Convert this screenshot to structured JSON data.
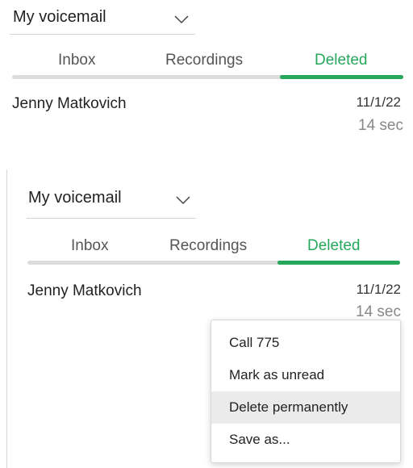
{
  "top_panel": {
    "folder_select": {
      "value": "My voicemail"
    },
    "tabs": [
      {
        "label": "Inbox"
      },
      {
        "label": "Recordings"
      },
      {
        "label": "Deleted",
        "active": true
      }
    ],
    "voicemail_row": {
      "name": "Jenny Matkovich",
      "date": "11/1/22",
      "duration": "14 sec"
    }
  },
  "bottom_panel": {
    "folder_select": {
      "value": "My voicemail"
    },
    "tabs": [
      {
        "label": "Inbox"
      },
      {
        "label": "Recordings"
      },
      {
        "label": "Deleted",
        "active": true
      }
    ],
    "voicemail_row": {
      "name": "Jenny Matkovich",
      "date": "11/1/22",
      "duration": "14 sec"
    },
    "context_menu": {
      "items": [
        {
          "label": "Call 775"
        },
        {
          "label": "Mark as unread"
        },
        {
          "label": "Delete permanently",
          "highlighted": true
        },
        {
          "label": "Save as..."
        }
      ]
    }
  },
  "colors": {
    "accent": "#25a85c",
    "track": "#dcdcdc",
    "muted_text": "#888888",
    "menu_highlight": "#ebebeb"
  },
  "icons": {
    "dropdown": "chevron-down-icon"
  }
}
